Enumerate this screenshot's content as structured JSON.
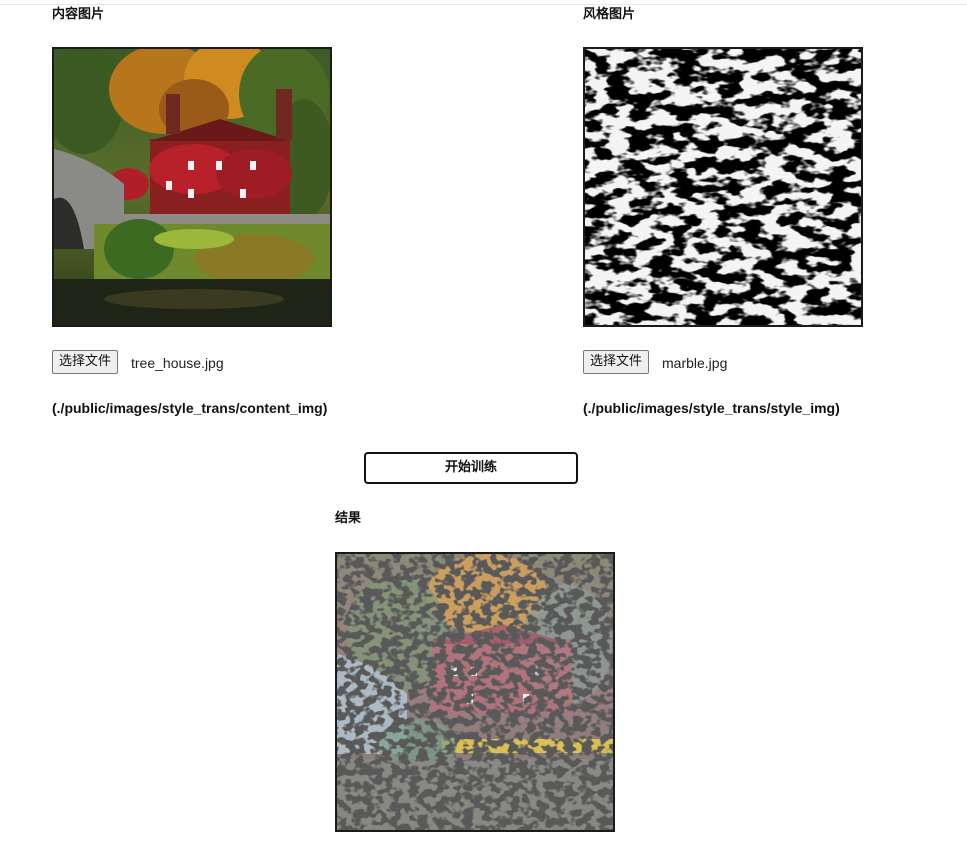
{
  "content_panel": {
    "title": "内容图片",
    "choose_button": "选择文件",
    "file_name": "tree_house.jpg",
    "path": "(./public/images/style_trans/content_img)"
  },
  "style_panel": {
    "title": "风格图片",
    "choose_button": "选择文件",
    "file_name": "marble.jpg",
    "path": "(./public/images/style_trans/style_img)"
  },
  "train_button": "开始训练",
  "result_panel": {
    "title": "结果"
  }
}
